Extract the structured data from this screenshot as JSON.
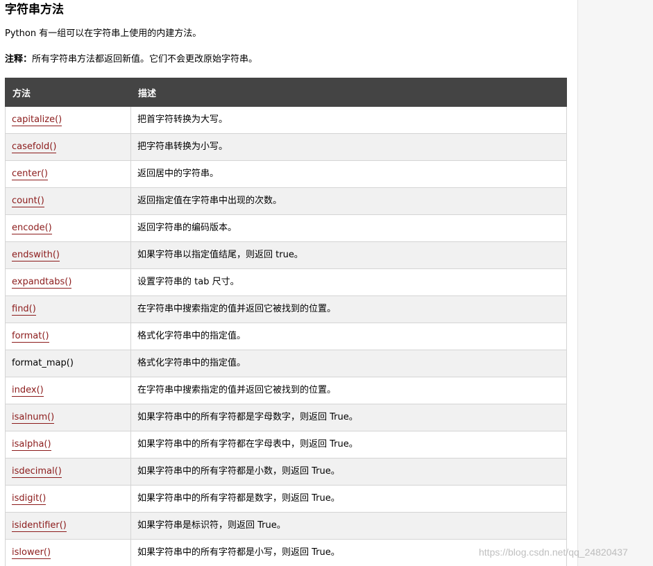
{
  "heading": "字符串方法",
  "intro": "Python 有一组可以在字符串上使用的内建方法。",
  "note": {
    "label": "注释：",
    "text": "所有字符串方法都返回新值。它们不会更改原始字符串。"
  },
  "table": {
    "headers": {
      "method": "方法",
      "description": "描述"
    },
    "rows": [
      {
        "method": "capitalize()",
        "description": "把首字符转换为大写。",
        "link": true
      },
      {
        "method": "casefold()",
        "description": "把字符串转换为小写。",
        "link": true
      },
      {
        "method": "center()",
        "description": "返回居中的字符串。",
        "link": true
      },
      {
        "method": "count()",
        "description": "返回指定值在字符串中出现的次数。",
        "link": true
      },
      {
        "method": "encode()",
        "description": "返回字符串的编码版本。",
        "link": true
      },
      {
        "method": "endswith()",
        "description": "如果字符串以指定值结尾，则返回 true。",
        "link": true
      },
      {
        "method": "expandtabs()",
        "description": "设置字符串的 tab 尺寸。",
        "link": true
      },
      {
        "method": "find()",
        "description": "在字符串中搜索指定的值并返回它被找到的位置。",
        "link": true
      },
      {
        "method": "format()",
        "description": "格式化字符串中的指定值。",
        "link": true
      },
      {
        "method": "format_map()",
        "description": "格式化字符串中的指定值。",
        "link": false
      },
      {
        "method": "index()",
        "description": "在字符串中搜索指定的值并返回它被找到的位置。",
        "link": true
      },
      {
        "method": "isalnum()",
        "description": "如果字符串中的所有字符都是字母数字，则返回 True。",
        "link": true
      },
      {
        "method": "isalpha()",
        "description": "如果字符串中的所有字符都在字母表中，则返回 True。",
        "link": true
      },
      {
        "method": "isdecimal()",
        "description": "如果字符串中的所有字符都是小数，则返回 True。",
        "link": true
      },
      {
        "method": "isdigit()",
        "description": "如果字符串中的所有字符都是数字，则返回 True。",
        "link": true
      },
      {
        "method": "isidentifier()",
        "description": "如果字符串是标识符，则返回 True。",
        "link": true
      },
      {
        "method": "islower()",
        "description": "如果字符串中的所有字符都是小写，则返回 True。",
        "link": true
      }
    ]
  },
  "watermark": "https://blog.csdn.net/qq_24820437",
  "colors": {
    "header_bg": "#444444",
    "link": "#8b1a1a",
    "row_alt": "#f1f1f1"
  }
}
